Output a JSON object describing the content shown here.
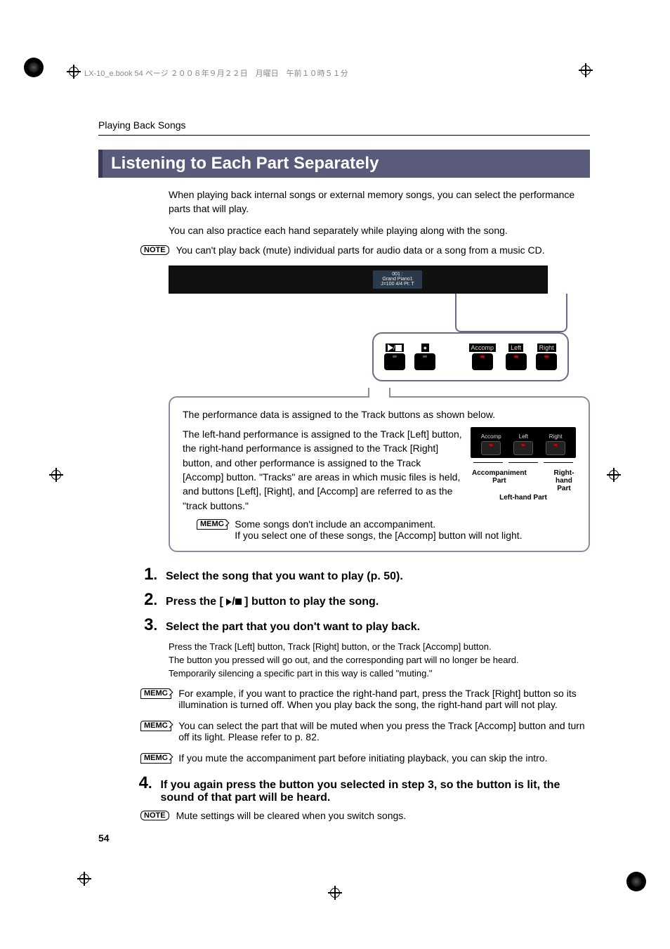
{
  "header_line": "LX-10_e.book  54 ページ  ２００８年９月２２日　月曜日　午前１０時５１分",
  "breadcrumb": "Playing Back Songs",
  "section_title": "Listening to Each Part Separately",
  "intro_1": "When playing back internal songs or external memory songs, you can select the performance parts that will play.",
  "intro_2": "You can also practice each hand separately while playing along with the song.",
  "note_badge": "NOTE",
  "memo_badge": "MEMO",
  "note_1": "You can't play back (mute) individual parts for audio data or a song from a music CD.",
  "panel_screen_line1": "001 :",
  "panel_screen_line2": "Grand Piano1",
  "panel_screen_line3": "J=100    4/4   Pt:  T",
  "callout_buttons": [
    {
      "label": "",
      "variant": "play-stop"
    },
    {
      "label": "",
      "variant": "rec"
    },
    {
      "label": "Accomp"
    },
    {
      "label": "Left"
    },
    {
      "label": "Right"
    }
  ],
  "infobox": {
    "p1": "The performance data is assigned to the Track buttons as shown below.",
    "p2": "The left-hand performance is assigned to the Track [Left] button, the right-hand performance is assigned to the Track [Right] button, and other performance is assigned to the Track [Accomp] button. \"Tracks\" are areas in which music files is held, and buttons [Left], [Right], and [Accomp] are referred to as the \"track buttons.\"",
    "track_labels": [
      "Accomp",
      "Left",
      "Right"
    ],
    "legend_accomp": "Accompaniment Part",
    "legend_right": "Right-hand Part",
    "legend_left": "Left-hand Part",
    "memo_1a": "Some songs don't include an accompaniment.",
    "memo_1b": "If you select one of these songs, the [Accomp] button will not light."
  },
  "steps": {
    "s1": "Select the song that you want to play (p. 50).",
    "s2_a": "Press the [ ",
    "s2_b": " ] button to play the song.",
    "s3": "Select the part that you don't want to play back.",
    "s3_body_1": "Press the Track [Left] button, Track [Right] button, or the Track [Accomp] button.",
    "s3_body_2": "The button you pressed will go out, and the corresponding part will no longer be heard.",
    "s3_body_3": "Temporarily silencing a specific part in this way is called \"muting.\"",
    "s3_memo_1": "For example, if you want to practice the right-hand part, press the Track [Right] button so its illumination is turned off. When you play back the song, the right-hand part will not play.",
    "s3_memo_2": "You can select the part that will be muted when you press the Track [Accomp] button and turn off its light. Please refer to p. 82.",
    "s3_memo_3": "If you mute the accompaniment part before initiating playback, you can skip the intro.",
    "s4": "If you again press the button you selected in step 3, so the button is lit, the sound of that part will be heard.",
    "s4_note": "Mute settings will be cleared when you switch songs."
  },
  "page_number": "54"
}
